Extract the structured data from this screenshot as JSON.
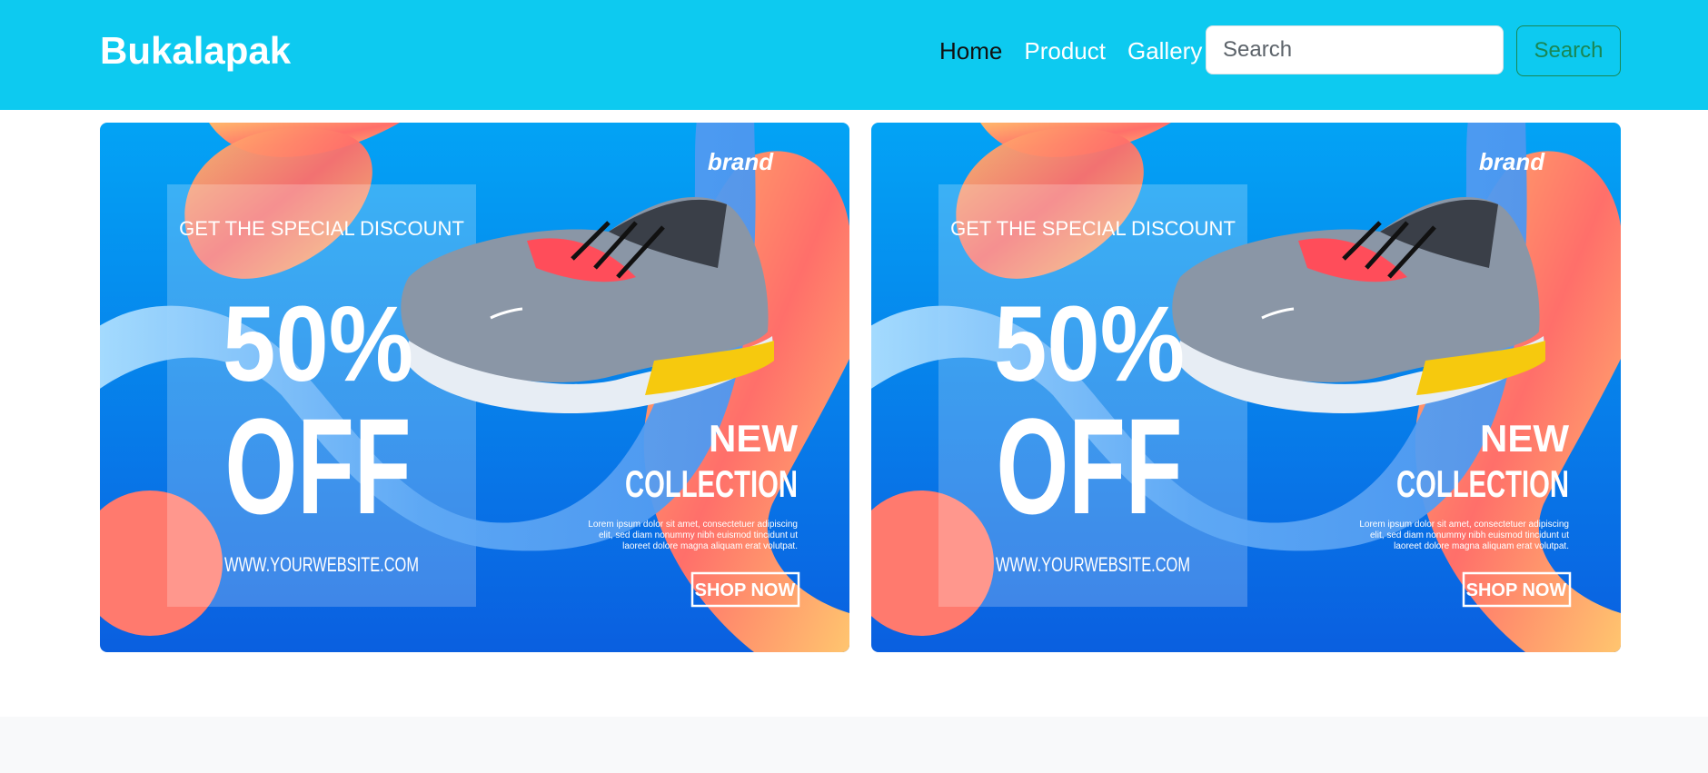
{
  "navbar": {
    "brand": "Bukalapak",
    "links": [
      {
        "label": "Home",
        "active": true
      },
      {
        "label": "Product",
        "active": false
      },
      {
        "label": "Gallery",
        "active": false
      }
    ],
    "search": {
      "placeholder": "Search",
      "button_label": "Search"
    },
    "bg_color": "#0dcaf0"
  },
  "banners": [
    {
      "brand": "brand",
      "headline": "GET THE SPECIAL DISCOUNT",
      "percent": "50%",
      "off": "OFF",
      "website": "WWW.YOURWEBSITE.COM",
      "new": "NEW",
      "collection": "COLLECTION",
      "lorem": [
        "Lorem ipsum dolor sit amet, consectetuer adipiscing",
        "elit, sed diam nonummy nibh euismod tincidunt ut",
        "laoreet dolore magna aliquam erat volutpat."
      ],
      "cta": "SHOP NOW"
    },
    {
      "brand": "brand",
      "headline": "GET THE SPECIAL DISCOUNT",
      "percent": "50%",
      "off": "OFF",
      "website": "WWW.YOURWEBSITE.COM",
      "new": "NEW",
      "collection": "COLLECTION",
      "lorem": [
        "Lorem ipsum dolor sit amet, consectetuer adipiscing",
        "elit, sed diam nonummy nibh euismod tincidunt ut",
        "laoreet dolore magna aliquam erat volutpat."
      ],
      "cta": "SHOP NOW"
    }
  ]
}
